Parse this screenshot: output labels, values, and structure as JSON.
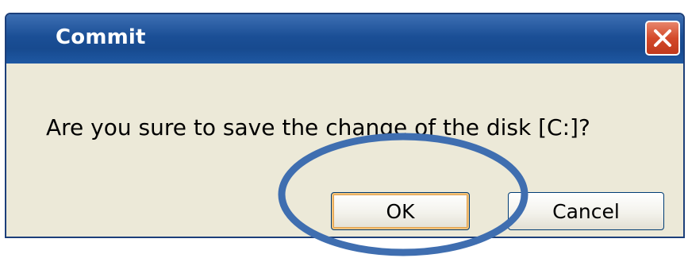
{
  "dialog": {
    "title": "Commit",
    "message": "Are you sure to save the change of the disk [C:]?",
    "close_icon": "close-icon",
    "ok_label": "OK",
    "cancel_label": "Cancel"
  },
  "annotation": {
    "shape": "ellipse",
    "color": "#3f6eb0",
    "target": "ok-button"
  }
}
